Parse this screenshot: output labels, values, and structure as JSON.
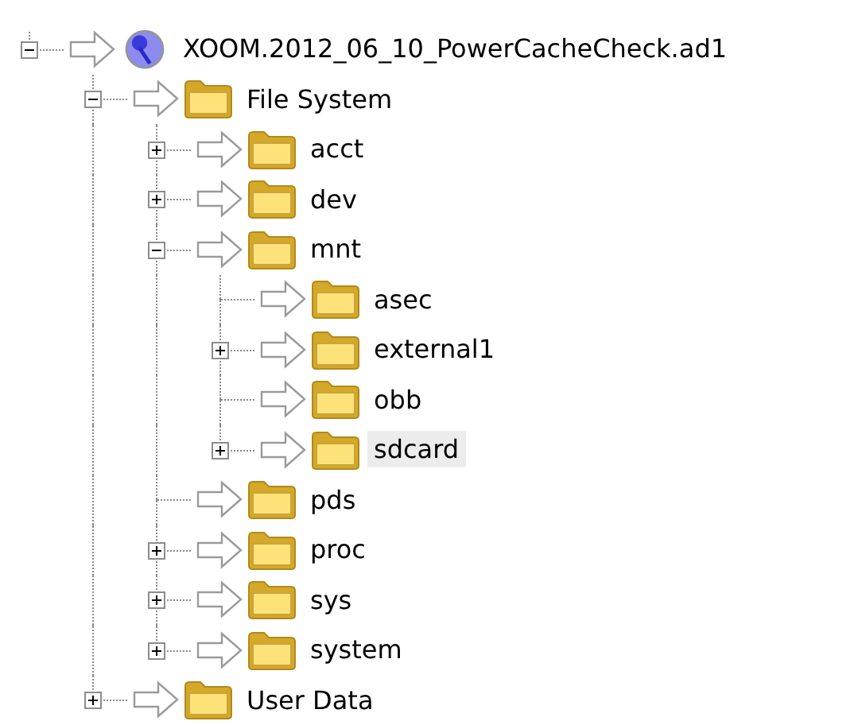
{
  "tree": {
    "label": "XOOM.2012_06_10_PowerCacheCheck.ad1",
    "kind": "evidence",
    "expanded": true,
    "selected": false,
    "children": [
      {
        "label": "File System",
        "kind": "folder",
        "expanded": true,
        "selected": false,
        "children": [
          {
            "label": "acct",
            "kind": "folder",
            "expanded": false,
            "selected": false
          },
          {
            "label": "dev",
            "kind": "folder",
            "expanded": false,
            "selected": false
          },
          {
            "label": "mnt",
            "kind": "folder",
            "expanded": true,
            "selected": false,
            "children": [
              {
                "label": "asec",
                "kind": "folder",
                "selected": false
              },
              {
                "label": "external1",
                "kind": "folder",
                "expanded": false,
                "selected": false
              },
              {
                "label": "obb",
                "kind": "folder",
                "selected": false
              },
              {
                "label": "sdcard",
                "kind": "folder",
                "expanded": false,
                "selected": true
              }
            ]
          },
          {
            "label": "pds",
            "kind": "folder",
            "selected": false
          },
          {
            "label": "proc",
            "kind": "folder",
            "expanded": false,
            "selected": false
          },
          {
            "label": "sys",
            "kind": "folder",
            "expanded": false,
            "selected": false
          },
          {
            "label": "system",
            "kind": "folder",
            "expanded": false,
            "selected": false
          }
        ]
      },
      {
        "label": "User Data",
        "kind": "folder",
        "expanded": false,
        "selected": false
      }
    ]
  }
}
